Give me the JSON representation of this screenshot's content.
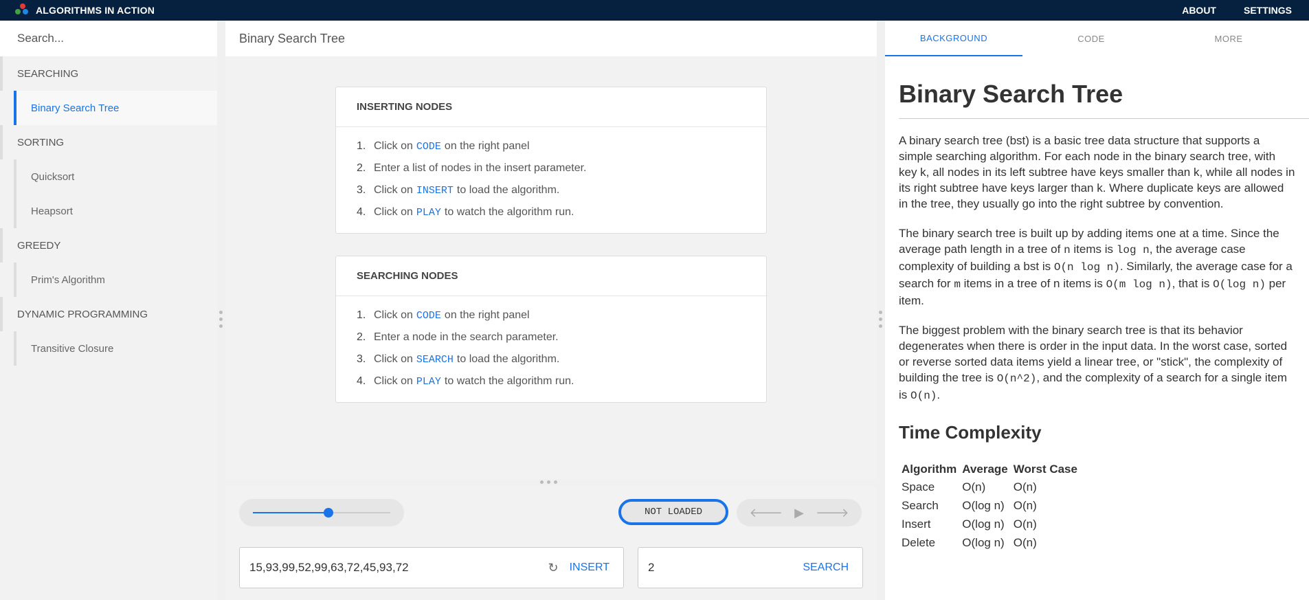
{
  "app": {
    "title": "ALGORITHMS IN ACTION",
    "nav": [
      "ABOUT",
      "SETTINGS"
    ],
    "logo_colors": [
      "#e53935",
      "#43a047",
      "#1e88e5"
    ]
  },
  "sidebar": {
    "search_placeholder": "Search...",
    "categories": [
      {
        "label": "SEARCHING",
        "items": [
          {
            "label": "Binary Search Tree",
            "active": true
          }
        ]
      },
      {
        "label": "SORTING",
        "items": [
          {
            "label": "Quicksort"
          },
          {
            "label": "Heapsort"
          }
        ]
      },
      {
        "label": "GREEDY",
        "items": [
          {
            "label": "Prim's Algorithm"
          }
        ]
      },
      {
        "label": "DYNAMIC PROGRAMMING",
        "items": [
          {
            "label": "Transitive Closure"
          }
        ]
      }
    ]
  },
  "center": {
    "title": "Binary Search Tree",
    "cards": [
      {
        "heading": "INSERTING NODES",
        "steps": [
          {
            "num": "1.",
            "pre": "Click on",
            "code": "CODE",
            "post": "on the right panel"
          },
          {
            "num": "2.",
            "pre": "Enter a list of nodes in the insert parameter.",
            "code": "",
            "post": ""
          },
          {
            "num": "3.",
            "pre": "Click on",
            "code": "INSERT",
            "post": "to load the algorithm."
          },
          {
            "num": "4.",
            "pre": "Click on",
            "code": "PLAY",
            "post": "to watch the algorithm run."
          }
        ]
      },
      {
        "heading": "SEARCHING NODES",
        "steps": [
          {
            "num": "1.",
            "pre": "Click on",
            "code": "CODE",
            "post": "on the right panel"
          },
          {
            "num": "2.",
            "pre": "Enter a node in the search parameter.",
            "code": "",
            "post": ""
          },
          {
            "num": "3.",
            "pre": "Click on",
            "code": "SEARCH",
            "post": "to load the algorithm."
          },
          {
            "num": "4.",
            "pre": "Click on",
            "code": "PLAY",
            "post": "to watch the algorithm run."
          }
        ]
      }
    ],
    "controls": {
      "speed_level": 0.55,
      "status": "NOT LOADED",
      "insert_value": "15,93,99,52,99,63,72,45,93,72",
      "insert_label": "INSERT",
      "search_value": "2",
      "search_label": "SEARCH"
    }
  },
  "right": {
    "tabs": [
      {
        "label": "BACKGROUND",
        "active": true
      },
      {
        "label": "CODE"
      },
      {
        "label": "MORE"
      }
    ],
    "heading": "Binary Search Tree",
    "para1": "A binary search tree (bst) is a basic tree data structure that supports a simple searching algorithm. For each node in the binary search tree, with key k, all nodes in its left subtree have keys smaller than k, while all nodes in its right subtree have keys larger than k. Where duplicate keys are allowed in the tree, they usually go into the right subtree by convention.",
    "para2_parts": [
      "The binary search tree is built up by adding items one at a time. Since the average path length in a tree of ",
      "n",
      " items is ",
      "log n",
      ", the average case complexity of building a bst is ",
      "O(n log n)",
      ". Similarly, the average case for a search for ",
      "m",
      " items in a tree of n items is ",
      "O(m log n)",
      ", that is ",
      "O(log n)",
      " per item."
    ],
    "para3_parts": [
      "The biggest problem with the binary search tree is that its behavior degenerates when there is order in the input data. In the worst case, sorted or reverse sorted data items yield a linear tree, or \"stick\", the complexity of building the tree is ",
      "O(n^2)",
      ", and the complexity of a search for a single item is ",
      "O(n)",
      "."
    ],
    "subheading": "Time Complexity",
    "table": {
      "headers": [
        "Algorithm",
        "Average",
        "Worst Case"
      ],
      "rows": [
        [
          "Space",
          "O(n)",
          "O(n)"
        ],
        [
          "Search",
          "O(log n)",
          "O(n)"
        ],
        [
          "Insert",
          "O(log n)",
          "O(n)"
        ],
        [
          "Delete",
          "O(log n)",
          "O(n)"
        ]
      ]
    }
  }
}
